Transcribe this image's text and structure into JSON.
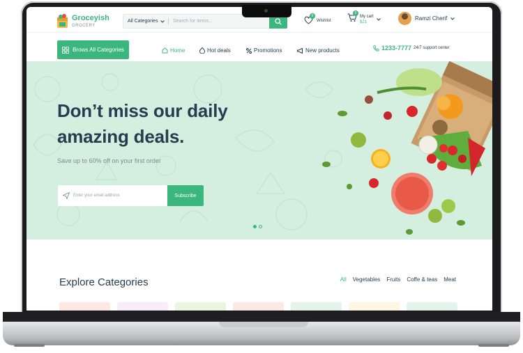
{
  "header": {
    "logo_name": "Groceyish",
    "logo_sub": "GROCERY",
    "category_select": "All Categories",
    "search_placeholder": "Search for items...",
    "wishlist_label": "Wishlist",
    "wishlist_count": "0",
    "cart_label": "My cart",
    "cart_price": "$21",
    "cart_count": "0",
    "user_name": "Ramzi Cherif"
  },
  "nav": {
    "browse_label": "Brows All Categories",
    "items": [
      {
        "label": "Home",
        "icon": "home-icon",
        "active": true
      },
      {
        "label": "Hot deals",
        "icon": "flame-icon",
        "active": false
      },
      {
        "label": "Promotions",
        "icon": "percent-icon",
        "active": false
      },
      {
        "label": "New products",
        "icon": "megaphone-icon",
        "active": false
      }
    ],
    "phone": "1233-7777",
    "support": "24/7 support center"
  },
  "hero": {
    "title_line1": "Don’t miss our daily",
    "title_line2": "amazing deals.",
    "subtitle": "Save up to 60% off on your first order",
    "email_placeholder": "Enter your email address",
    "subscribe_label": "Subscribe"
  },
  "categories": {
    "title": "Explore Categories",
    "tabs": [
      "All",
      "Vegetables",
      "Fruits",
      "Coffe & teas",
      "Meat"
    ],
    "active_tab": "All"
  },
  "colors": {
    "brand": "#3bb77e",
    "hero_bg": "#d4efe0",
    "text_dark": "#253d4e"
  }
}
